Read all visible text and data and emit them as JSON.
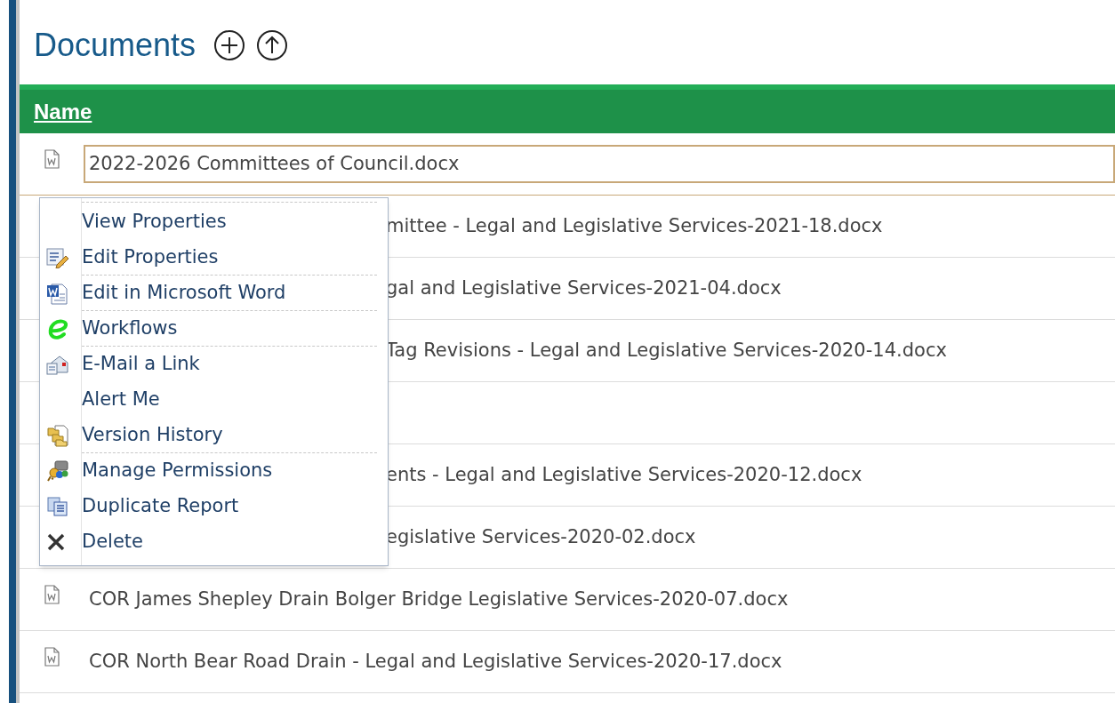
{
  "title": "Documents",
  "table": {
    "columns": [
      "Name"
    ],
    "rows": [
      {
        "kind": "full",
        "name": "2022-2026 Committees of Council.docx",
        "selected": true
      },
      {
        "kind": "partial",
        "name": "mittee - Legal and Legislative Services-2021-18.docx",
        "selected": false
      },
      {
        "kind": "partial",
        "name": "gal and Legislative Services-2021-04.docx",
        "selected": false
      },
      {
        "kind": "partial",
        "name": "Tag Revisions - Legal and Legislative Services-2020-14.docx",
        "selected": false
      },
      {
        "kind": "empty",
        "selected": false
      },
      {
        "kind": "partial",
        "name": "ents - Legal and Legislative Services-2020-12.docx",
        "selected": false
      },
      {
        "kind": "partial",
        "name": "egislative Services-2020-02.docx",
        "selected": false
      },
      {
        "kind": "full",
        "name": "COR James Shepley Drain Bolger Bridge Legislative Services-2020-07.docx",
        "selected": false
      },
      {
        "kind": "full",
        "name": "COR North Bear Road Drain - Legal and Legislative Services-2020-17.docx",
        "selected": false
      }
    ]
  },
  "context_menu": {
    "items": [
      {
        "label": "View Properties",
        "separator_after": false
      },
      {
        "label": "Edit Properties",
        "separator_after": true
      },
      {
        "label": "Edit in Microsoft Word",
        "separator_after": true
      },
      {
        "label": "Workflows",
        "separator_after": true
      },
      {
        "label": "E-Mail a Link",
        "separator_after": false
      },
      {
        "label": "Alert Me",
        "separator_after": false
      },
      {
        "label": "Version History",
        "separator_after": true
      },
      {
        "label": "Manage Permissions",
        "separator_after": false
      },
      {
        "label": "Duplicate Report",
        "separator_after": false
      },
      {
        "label": "Delete",
        "separator_after": false
      }
    ]
  }
}
